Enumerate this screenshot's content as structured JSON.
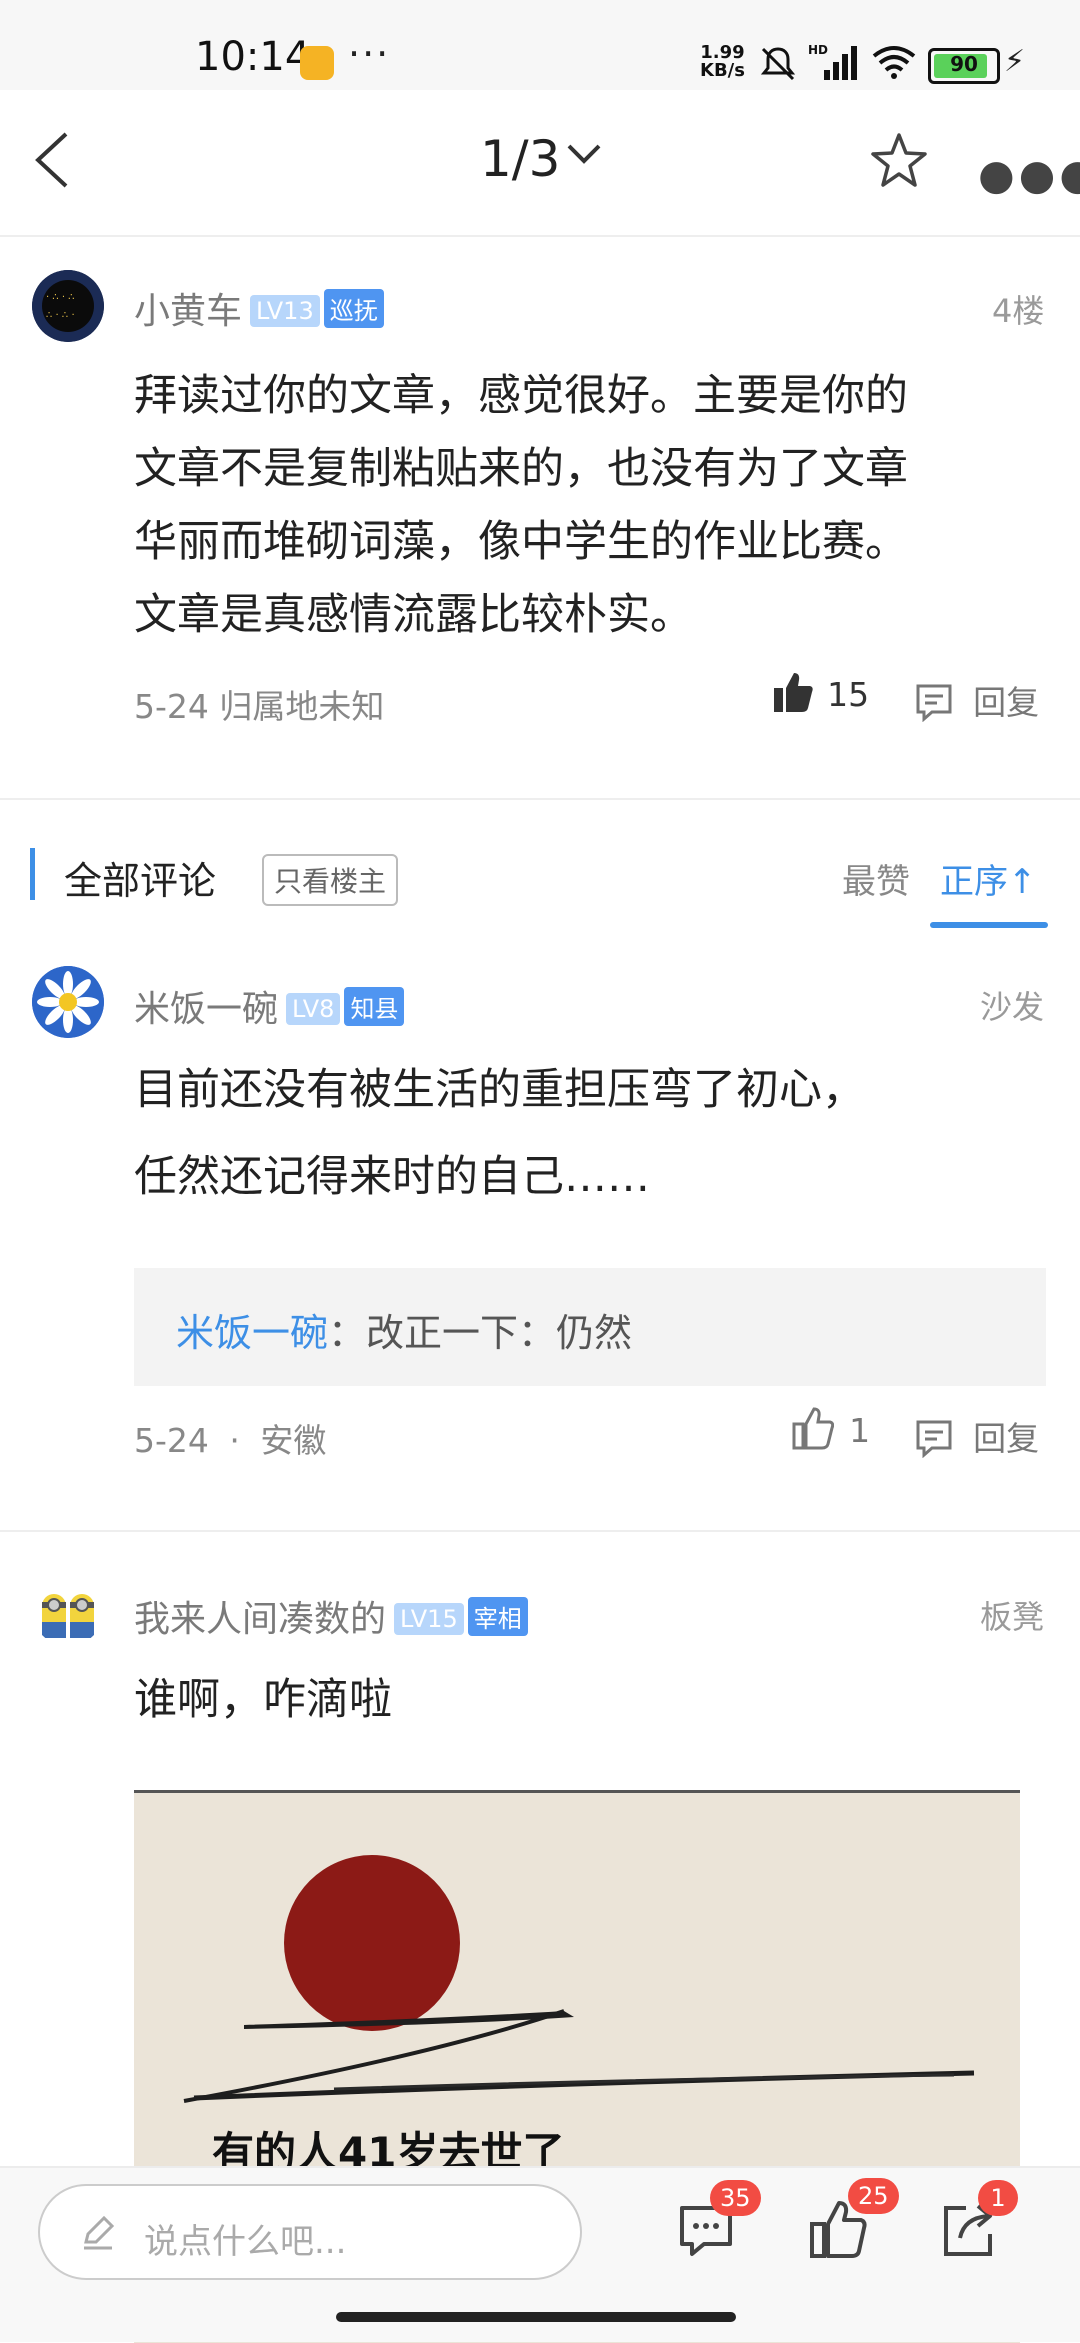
{
  "status_bar": {
    "time": "10:14",
    "more": "···",
    "net_speed_value": "1.99",
    "net_speed_unit": "KB/s",
    "battery": "90",
    "icons": [
      "app-notification-icon",
      "mute-icon",
      "hd-signal-icon",
      "wifi-icon",
      "battery-icon",
      "charging-icon"
    ]
  },
  "nav": {
    "page": "1/3",
    "icons": [
      "back-icon",
      "chevron-down-icon",
      "star-icon",
      "more-icon"
    ]
  },
  "post": {
    "user": "小黄车",
    "level": "LV13",
    "title": "巡抚",
    "floor": "4楼",
    "lines": [
      "拜读过你的文章，感觉很好。主要是你的",
      "文章不是复制粘贴来的，也没有为了文章",
      "华丽而堆砌词藻，像中学生的作业比赛。",
      "文章是真感情流露比较朴实。"
    ],
    "meta": "5-24 归属地未知",
    "likes": "15",
    "reply_label": "回复"
  },
  "section": {
    "title": "全部评论",
    "owner_only": "只看楼主",
    "sort_likes": "最赞",
    "sort_asc": "正序↑"
  },
  "comments": [
    {
      "user": "米饭一碗",
      "level": "LV8",
      "title": "知县",
      "floor": "沙发",
      "lines": [
        "目前还没有被生活的重担压弯了初心，",
        "任然还记得来时的自己……"
      ],
      "sub_reply_user": "米饭一碗",
      "sub_reply_text": "：改正一下：仍然",
      "date": "5-24",
      "location": "安徽",
      "likes": "1",
      "reply_label": "回复"
    },
    {
      "user": "我来人间凑数的",
      "level": "LV15",
      "title": "宰相",
      "floor": "板凳",
      "lines": [
        "谁啊，咋滴啦"
      ],
      "image_caption": "有的人41岁去世了"
    }
  ],
  "bottom_bar": {
    "placeholder": "说点什么吧...",
    "comment_count": "35",
    "like_count": "25",
    "share_count": "1"
  },
  "colors": {
    "accent": "#3d8fe6",
    "badge_red": "#f24c43",
    "level_badge": "#b7d6fb",
    "title_badge": "#4f95f1"
  }
}
